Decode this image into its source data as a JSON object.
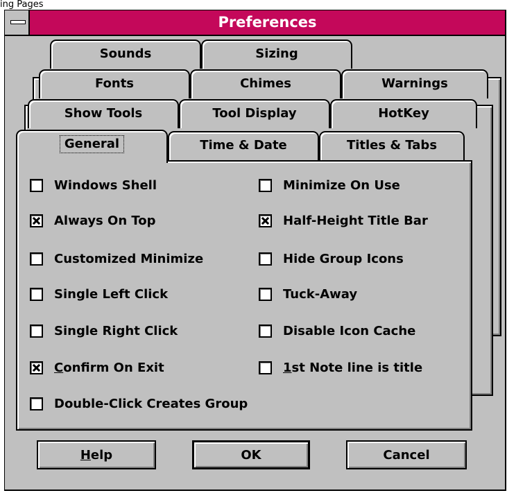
{
  "caption": "ing Pages",
  "window": {
    "title": "Preferences"
  },
  "tabs": {
    "row4": [
      "Sounds",
      "Sizing"
    ],
    "row3": [
      "Fonts",
      "Chimes",
      "Warnings"
    ],
    "row2": [
      "Show Tools",
      "Tool Display",
      "HotKey"
    ],
    "row1": [
      "General",
      "Time & Date",
      "Titles & Tabs"
    ],
    "active": "General"
  },
  "options": {
    "left": [
      {
        "label": "Windows Shell",
        "checked": false
      },
      {
        "label": "Always On Top",
        "checked": true
      },
      {
        "label": "Customized Minimize",
        "checked": false
      },
      {
        "label": "Single Left Click",
        "checked": false
      },
      {
        "label": "Single Right Click",
        "checked": false
      },
      {
        "label": "Confirm On Exit",
        "checked": true,
        "mnemonic": "C"
      },
      {
        "label": "Double-Click Creates Group",
        "checked": false
      }
    ],
    "right": [
      {
        "label": "Minimize On Use",
        "checked": false
      },
      {
        "label": "Half-Height Title Bar",
        "checked": true
      },
      {
        "label": "Hide Group Icons",
        "checked": false
      },
      {
        "label": "Tuck-Away",
        "checked": false
      },
      {
        "label": "Disable Icon Cache",
        "checked": false
      },
      {
        "label": "1st Note line is title",
        "checked": false,
        "mnemonic": "1"
      }
    ]
  },
  "buttons": {
    "help": "Help",
    "ok": "OK",
    "cancel": "Cancel"
  }
}
